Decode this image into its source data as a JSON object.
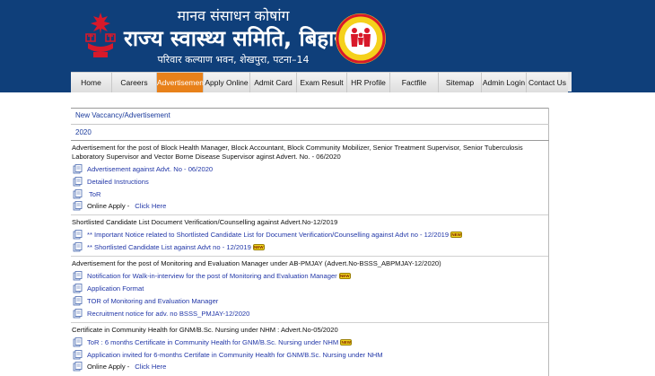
{
  "header": {
    "line1": "मानव संसाधन कोषांग",
    "line2": "राज्य स्वास्थ्य समिति, बिहार",
    "line3": "परिवार कल्याण भवन, शेखपुरा, पटना–14",
    "colors": {
      "header_bg": "#0f3f7a",
      "nav_active": "#e8811a",
      "link": "#2338a8"
    }
  },
  "nav": {
    "items": [
      {
        "label": "Home"
      },
      {
        "label": "Careers"
      },
      {
        "label": "Advertisement",
        "active": true
      },
      {
        "label": "Apply Online"
      },
      {
        "label": "Admit Card"
      },
      {
        "label": "Exam Result"
      },
      {
        "label": "HR Profile"
      },
      {
        "label": "Factfile"
      },
      {
        "label": "Sitemap"
      },
      {
        "label": "Admin Login"
      },
      {
        "label": "Contact Us"
      }
    ]
  },
  "content": {
    "breadcrumb": "New Vaccancy/Advertisement",
    "year": "2020",
    "new_badge": "NEW",
    "sections": [
      {
        "heading": "Advertisement for the post of Block Health Manager, Block Accountant, Block Community Mobilizer, Senior Treatment Supervisor, Senior Tuberculosis Laboratory Supervisor and Vector Borne Disease Supervisor aginst Advert. No. - 06/2020",
        "items": [
          {
            "text": "Advertisement against Advt. No - 06/2020"
          },
          {
            "text": "Detailed Instructions"
          },
          {
            "text": "ToR"
          },
          {
            "label": "Online Apply -",
            "text": "Click Here"
          }
        ]
      },
      {
        "heading": "Shortlisted Candidate List Document Verification/Counselling against Advert.No-12/2019",
        "items": [
          {
            "text": "** Important Notice related to Shortlisted Candidate List for Document Verification/Counselling against Advt no - 12/2019"
          },
          {
            "text": "** Shortlisted Candidate List against Advt no - 12/2019"
          }
        ]
      },
      {
        "heading": "Advertisement for the post of Monitoring and Evaluation Manager under AB-PMJAY (Advert.No-BSSS_ABPMJAY-12/2020)",
        "items": [
          {
            "text": "Notification for Walk-in-interview for the post of Monitoring and Evaluation Manager"
          },
          {
            "text": "Application Format"
          },
          {
            "text": "TOR of Monitoring and Evaluation Manager"
          },
          {
            "text": "Recruitment notice for adv. no BSSS_PMJAY-12/2020"
          }
        ]
      },
      {
        "heading": "Certificate in Community Health for GNM/B.Sc. Nursing under NHM : Advert.No-05/2020",
        "items": [
          {
            "text": "ToR : 6 months Certificate in Community Health for GNM/B.Sc. Nursing under NHM"
          },
          {
            "text": "Application invited for 6-months Certifate in Community Health for GNM/B.Sc. Nursing under NHM"
          },
          {
            "label": "Online Apply -",
            "text": "Click Here"
          }
        ]
      }
    ]
  }
}
